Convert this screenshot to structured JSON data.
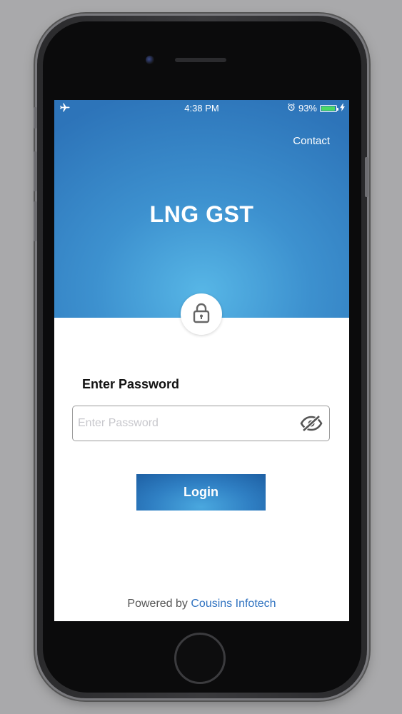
{
  "status_bar": {
    "time": "4:38 PM",
    "battery_percent": "93%",
    "battery_level": 0.93,
    "icons": [
      "airplane-icon",
      "alarm-icon",
      "battery-icon",
      "charging-icon"
    ]
  },
  "header": {
    "contact_label": "Contact",
    "app_title": "LNG GST",
    "lock_icon": "lock-icon"
  },
  "login_form": {
    "field_label": "Enter Password",
    "password_placeholder": "Enter Password",
    "password_value": "",
    "visibility_icon": "eye-slash-icon",
    "login_label": "Login"
  },
  "footer": {
    "powered_by": "Powered by",
    "company": "Cousins Infotech"
  },
  "colors": {
    "header_blue": "#3d91cf",
    "accent_link": "#2f72c0",
    "battery_green": "#4cd964"
  }
}
